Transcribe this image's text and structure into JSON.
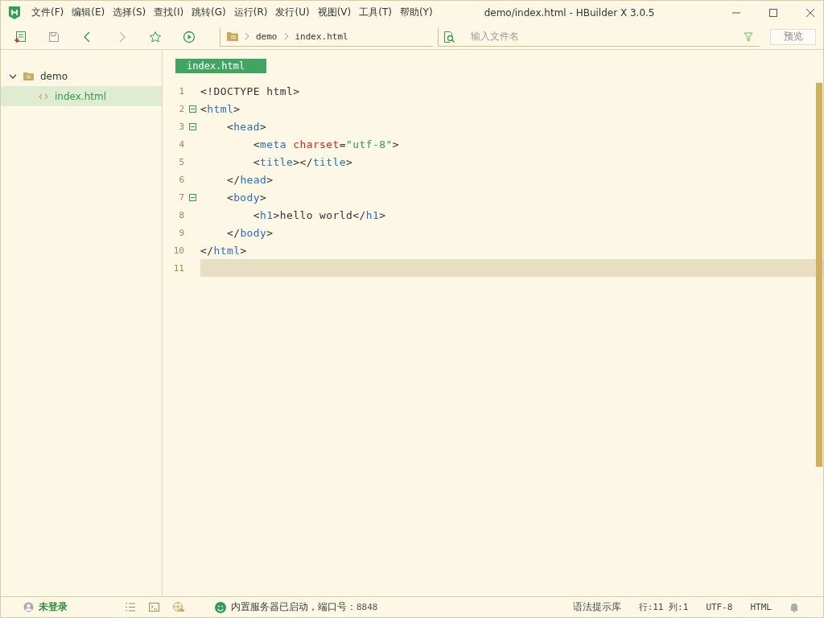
{
  "window": {
    "title": "demo/index.html - HBuilder X 3.0.5"
  },
  "menu": [
    "文件(F)",
    "编辑(E)",
    "选择(S)",
    "查找(I)",
    "跳转(G)",
    "运行(R)",
    "发行(U)",
    "视图(V)",
    "工具(T)",
    "帮助(Y)"
  ],
  "toolbar": {
    "breadcrumb": [
      "demo",
      "index.html"
    ],
    "search": {
      "placeholder": "输入文件名"
    },
    "preview_button": "预览"
  },
  "sidebar": {
    "items": [
      {
        "label": "demo",
        "kind": "folder",
        "expanded": true,
        "selected": false,
        "children": [
          {
            "label": "index.html",
            "kind": "file",
            "selected": true
          }
        ]
      }
    ]
  },
  "editor": {
    "tab": "index.html",
    "lines": [
      {
        "number": "1",
        "fold": false,
        "selected": false,
        "tokens": [
          {
            "kind": "punct",
            "text": "<!DOCTYPE html>"
          }
        ]
      },
      {
        "number": "2",
        "fold": true,
        "selected": false,
        "tokens": [
          {
            "kind": "punct",
            "text": "<"
          },
          {
            "kind": "tag",
            "text": "html"
          },
          {
            "kind": "punct",
            "text": ">"
          }
        ]
      },
      {
        "number": "3",
        "fold": true,
        "selected": false,
        "tokens": [
          {
            "kind": "punct",
            "text": "    <"
          },
          {
            "kind": "tag",
            "text": "head"
          },
          {
            "kind": "punct",
            "text": ">"
          }
        ]
      },
      {
        "number": "4",
        "fold": false,
        "selected": false,
        "tokens": [
          {
            "kind": "punct",
            "text": "        <"
          },
          {
            "kind": "tag",
            "text": "meta"
          },
          {
            "kind": "attr",
            "text": " charset"
          },
          {
            "kind": "punct",
            "text": "="
          },
          {
            "kind": "string",
            "text": "\"utf-8\""
          },
          {
            "kind": "punct",
            "text": ">"
          }
        ]
      },
      {
        "number": "5",
        "fold": false,
        "selected": false,
        "tokens": [
          {
            "kind": "punct",
            "text": "        <"
          },
          {
            "kind": "tag",
            "text": "title"
          },
          {
            "kind": "punct",
            "text": "></"
          },
          {
            "kind": "tag",
            "text": "title"
          },
          {
            "kind": "punct",
            "text": ">"
          }
        ]
      },
      {
        "number": "6",
        "fold": false,
        "selected": false,
        "tokens": [
          {
            "kind": "punct",
            "text": "    </"
          },
          {
            "kind": "tag",
            "text": "head"
          },
          {
            "kind": "punct",
            "text": ">"
          }
        ]
      },
      {
        "number": "7",
        "fold": true,
        "selected": false,
        "tokens": [
          {
            "kind": "punct",
            "text": "    <"
          },
          {
            "kind": "tag",
            "text": "body"
          },
          {
            "kind": "punct",
            "text": ">"
          }
        ]
      },
      {
        "number": "8",
        "fold": false,
        "selected": false,
        "tokens": [
          {
            "kind": "punct",
            "text": "        <"
          },
          {
            "kind": "tag",
            "text": "h1"
          },
          {
            "kind": "punct",
            "text": ">hello world</"
          },
          {
            "kind": "tag",
            "text": "h1"
          },
          {
            "kind": "punct",
            "text": ">"
          }
        ]
      },
      {
        "number": "9",
        "fold": false,
        "selected": false,
        "tokens": [
          {
            "kind": "punct",
            "text": "    </"
          },
          {
            "kind": "tag",
            "text": "body"
          },
          {
            "kind": "punct",
            "text": ">"
          }
        ]
      },
      {
        "number": "10",
        "fold": false,
        "selected": false,
        "tokens": [
          {
            "kind": "punct",
            "text": "</"
          },
          {
            "kind": "tag",
            "text": "html"
          },
          {
            "kind": "punct",
            "text": ">"
          }
        ]
      },
      {
        "number": "11",
        "fold": false,
        "selected": true
      }
    ]
  },
  "status_bar": {
    "user": "未登录",
    "server": "内置服务器已启动，端口号：",
    "port": "8848",
    "syntax": "语法提示库",
    "position": "行:11 列:1",
    "encoding": "UTF-8",
    "language": "HTML"
  }
}
